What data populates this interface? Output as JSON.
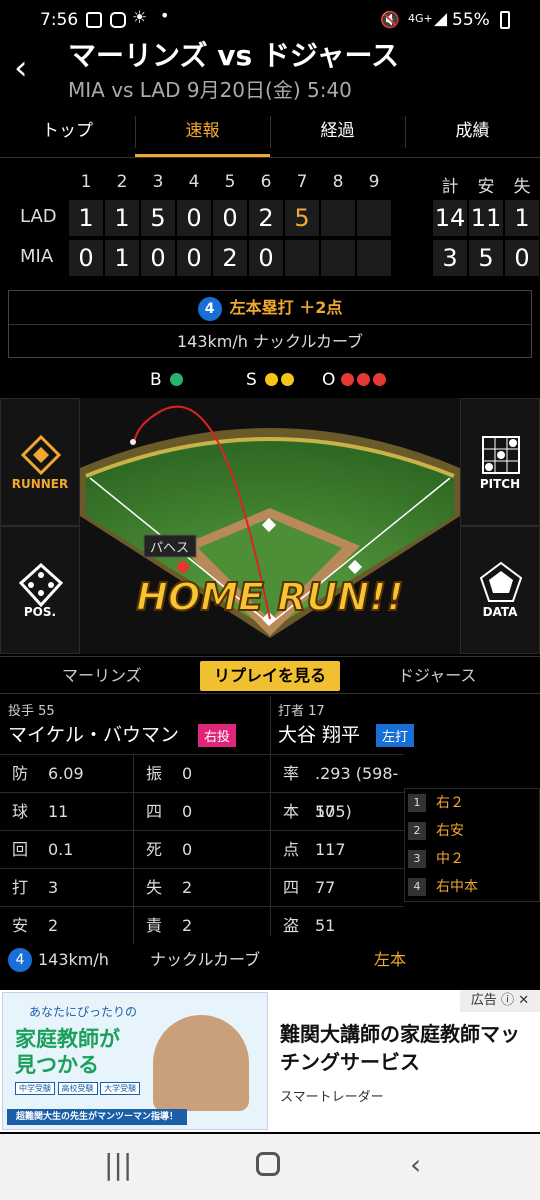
{
  "status": {
    "time": "7:56",
    "network": "4G+",
    "battery": "55%"
  },
  "header": {
    "title": "マーリンズ vs ドジャース",
    "subtitle": "MIA vs LAD 9月20日(金) 5:40"
  },
  "tabs": [
    "トップ",
    "速報",
    "経過",
    "成績"
  ],
  "active_tab": "速報",
  "scoreboard": {
    "innings": [
      "1",
      "2",
      "3",
      "4",
      "5",
      "6",
      "7",
      "8",
      "9"
    ],
    "rhe_labels": [
      "計",
      "安",
      "失"
    ],
    "teams": [
      {
        "name": "LAD",
        "scores": [
          "1",
          "1",
          "5",
          "0",
          "0",
          "2",
          "5",
          "",
          ""
        ],
        "rhe": [
          "14",
          "11",
          "1"
        ]
      },
      {
        "name": "MIA",
        "scores": [
          "0",
          "1",
          "0",
          "0",
          "2",
          "0",
          "",
          "",
          ""
        ],
        "rhe": [
          "3",
          "5",
          "0"
        ]
      }
    ]
  },
  "play": {
    "number": "4",
    "result": "左本塁打 ＋2点",
    "pitch": "143km/h ナックルカーブ"
  },
  "count": {
    "b": "B",
    "s": "S",
    "o": "O"
  },
  "field": {
    "runner": "RUNNER",
    "pitch": "PITCH",
    "pos": "POS.",
    "data": "DATA",
    "fielder": "パヘス",
    "banner": "HOME RUN!!"
  },
  "replay_bar": {
    "left": "マーリンズ",
    "button": "リプレイを見る",
    "right": "ドジャース"
  },
  "pitcher": {
    "header": "投手 55",
    "name": "マイケル・バウマン",
    "hand": "右投",
    "stats_left": [
      [
        "防",
        "6.09"
      ],
      [
        "球",
        "11"
      ],
      [
        "回",
        "0.1"
      ],
      [
        "打",
        "3"
      ],
      [
        "安",
        "2"
      ]
    ],
    "stats_right": [
      [
        "振",
        "0"
      ],
      [
        "四",
        "0"
      ],
      [
        "死",
        "0"
      ],
      [
        "失",
        "2"
      ],
      [
        "責",
        "2"
      ]
    ]
  },
  "batter": {
    "header": "打者 17",
    "name": "大谷 翔平",
    "hand": "左打",
    "stats": [
      [
        "率",
        ".293 (598-175)"
      ],
      [
        "本",
        "50"
      ],
      [
        "点",
        "117"
      ],
      [
        "四",
        "77"
      ],
      [
        "盗",
        "51"
      ]
    ],
    "at_bats": [
      [
        "1",
        "右２"
      ],
      [
        "2",
        "右安"
      ],
      [
        "3",
        "中２"
      ],
      [
        "4",
        "右中本"
      ]
    ]
  },
  "pitch_row": {
    "number": "4",
    "speed": "143km/h",
    "type": "ナックルカーブ",
    "result": "左本"
  },
  "ad": {
    "tag": "広告",
    "img_top": "あなたにぴったりの",
    "img_main1": "家庭教師が",
    "img_main2": "見つかる",
    "img_tags": [
      "中学受験",
      "高校受験",
      "大学受験"
    ],
    "img_bottom": "超難関大生の先生がマンツーマン指導！",
    "title": "難関大講師の家庭教師マッチングサービス",
    "source": "スマートレーダー"
  },
  "colors": {
    "accent": "#f0a830",
    "ball": "#27b36b",
    "strike": "#f5c518",
    "out": "#e53935",
    "badge": "#1a6fd6"
  }
}
